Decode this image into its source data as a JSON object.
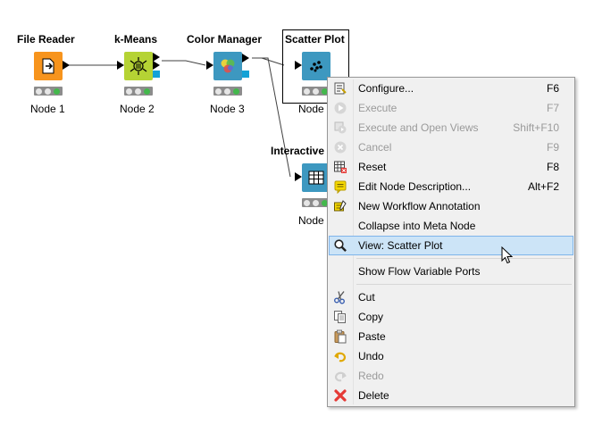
{
  "nodes": [
    {
      "title": "File Reader",
      "label": "Node 1",
      "icon": "file-reader-icon"
    },
    {
      "title": "k-Means",
      "label": "Node 2",
      "icon": "k-means-icon"
    },
    {
      "title": "Color Manager",
      "label": "Node 3",
      "icon": "color-manager-icon"
    },
    {
      "title": "Scatter Plot",
      "label": "Node",
      "icon": "scatter-plot-icon"
    },
    {
      "title": "Interactive",
      "label": "Node",
      "icon": "interactive-table-icon"
    }
  ],
  "colors": {
    "file_reader": "#f7941d",
    "k_means": "#b5d334",
    "view_node": "#3d98c0",
    "port_out": "#13a2d6",
    "menu_bg": "#f0f0f0",
    "menu_highlight": "#cce4f7",
    "disabled_text": "#9a9a9a"
  },
  "menu": {
    "items": [
      {
        "label": "Configure...",
        "shortcut": "F6",
        "icon": "configure-icon",
        "enabled": true
      },
      {
        "label": "Execute",
        "shortcut": "F7",
        "icon": "execute-icon",
        "enabled": false
      },
      {
        "label": "Execute and Open Views",
        "shortcut": "Shift+F10",
        "icon": "execute-open-views-icon",
        "enabled": false
      },
      {
        "label": "Cancel",
        "shortcut": "F9",
        "icon": "cancel-icon",
        "enabled": false
      },
      {
        "label": "Reset",
        "shortcut": "F8",
        "icon": "reset-icon",
        "enabled": true
      },
      {
        "label": "Edit Node Description...",
        "shortcut": "Alt+F2",
        "icon": "edit-description-icon",
        "enabled": true
      },
      {
        "label": "New Workflow Annotation",
        "shortcut": "",
        "icon": "annotation-icon",
        "enabled": true
      },
      {
        "label": "Collapse into Meta Node",
        "shortcut": "",
        "icon": "",
        "enabled": true
      },
      {
        "label": "View: Scatter Plot",
        "shortcut": "",
        "icon": "magnifier-icon",
        "enabled": true,
        "highlighted": true
      },
      {
        "label": "Show Flow Variable Ports",
        "shortcut": "",
        "icon": "",
        "enabled": true
      },
      {
        "label": "Cut",
        "shortcut": "",
        "icon": "scissors-icon",
        "enabled": true
      },
      {
        "label": "Copy",
        "shortcut": "",
        "icon": "copy-icon",
        "enabled": true
      },
      {
        "label": "Paste",
        "shortcut": "",
        "icon": "paste-icon",
        "enabled": true
      },
      {
        "label": "Undo",
        "shortcut": "",
        "icon": "undo-icon",
        "enabled": true
      },
      {
        "label": "Redo",
        "shortcut": "",
        "icon": "redo-icon",
        "enabled": false
      },
      {
        "label": "Delete",
        "shortcut": "",
        "icon": "delete-icon",
        "enabled": true
      }
    ]
  }
}
